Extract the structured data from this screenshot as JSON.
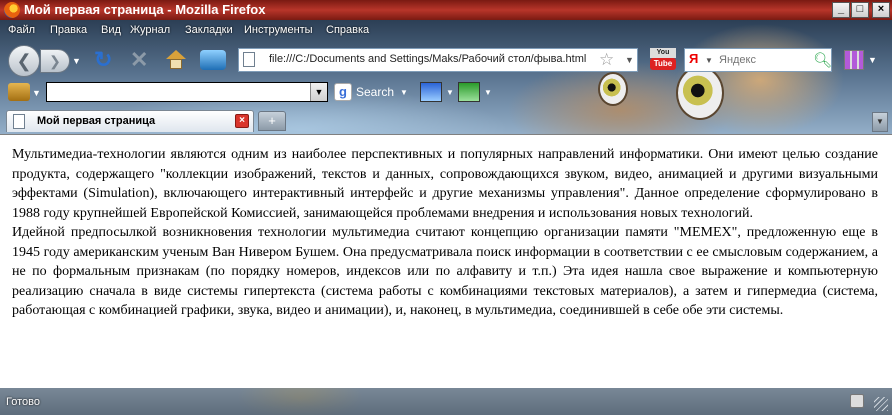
{
  "window": {
    "title": "Мой первая страница - Mozilla Firefox"
  },
  "menu": [
    "Файл",
    "Правка",
    "Вид",
    "Журнал",
    "Закладки",
    "Инструменты",
    "Справка"
  ],
  "nav": {
    "url": "file:///C:/Documents and Settings/Maks/Рабочий стол/фыва.html"
  },
  "yandex": {
    "logo": "Я",
    "placeholder": "Яндекс"
  },
  "youtube": {
    "top": "You",
    "bottom": "Tube"
  },
  "google_toolbar": {
    "search_label": "Search"
  },
  "tab": {
    "title": "Мой первая страница"
  },
  "content": {
    "paragraph1": "Мультимедиа-технологии являются одним из наиболее перспективных и популярных направлений информатики. Они имеют целью создание продукта, содержащего \"коллекции изображений, текстов и данных, сопровождающихся звуком, видео, анимацией и другими визуальными эффектами (Simulation), включающего интерактивный интерфейс и другие механизмы управления\". Данное определение сформулировано в 1988 году крупнейшей Европейской Комиссией, занимающейся проблемами внедрения и использования новых технологий.",
    "paragraph2": "Идейной предпосылкой возникновения технологии мультимедиа считают концепцию организации памяти \"MEMEX\", предложенную еще в 1945 году американским ученым Ван Нивером Бушем. Она предусматривала поиск информации в соответствии с ее смысловым содержанием, а не по формальным признакам (по порядку номеров, индексов или по алфавиту и т.п.) Эта идея нашла свое выражение и компьютерную реализацию сначала в виде системы гипертекста (система работы с комбинациями текстовых материалов), а затем и гипермедиа (система, работающая с комбинацией графики, звука, видео и анимации), и, наконец, в мультимедиа, соединившей в себе обе эти системы."
  },
  "status": {
    "text": "Готово"
  }
}
